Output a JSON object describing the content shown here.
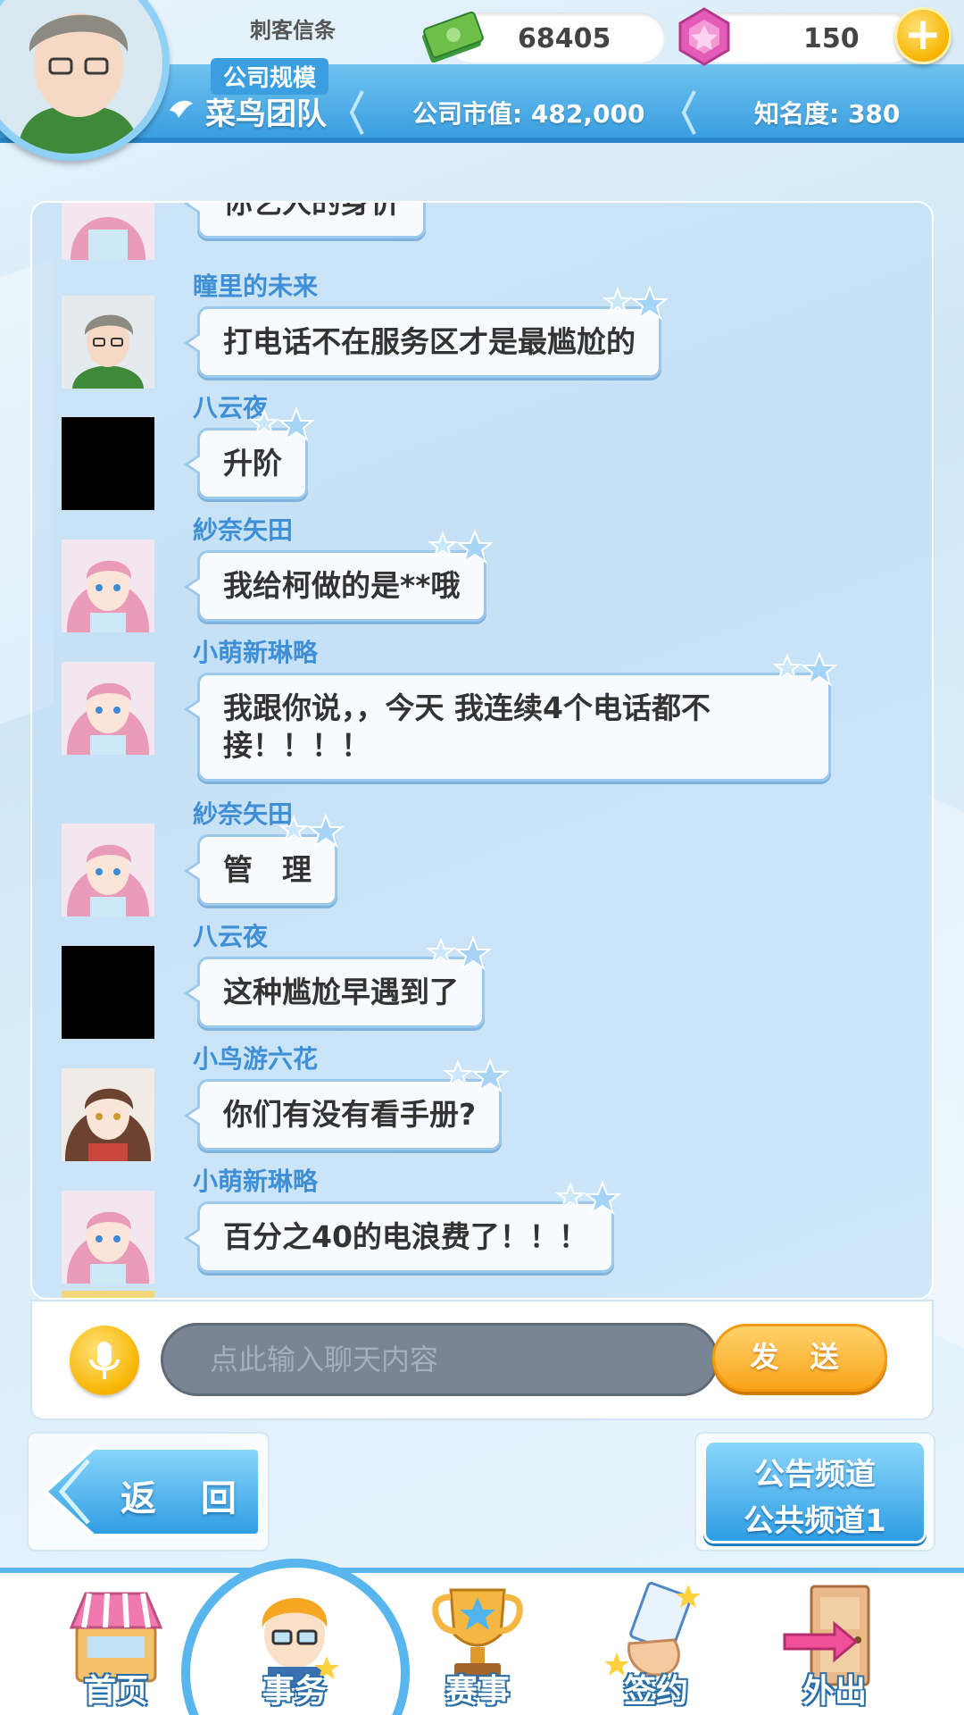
{
  "header": {
    "username": "刺客信条",
    "cash": "68405",
    "gems": "150",
    "scale_label": "公司规模",
    "team": "菜鸟团队",
    "market_value": "公司市值: 482,000",
    "fame": "知名度: 380"
  },
  "chat": {
    "messages": [
      {
        "name": "",
        "text": "你艺人的身价",
        "avatar": "pink-hair-girl"
      },
      {
        "name": "瞳里的未来",
        "text": "打电话不在服务区才是最尴尬的",
        "avatar": "glasses-boy"
      },
      {
        "name": "八云夜",
        "text": "升阶",
        "avatar": "black"
      },
      {
        "name": "紗奈矢田",
        "text": "我给柯做的是**哦",
        "avatar": "pink-hair-girl"
      },
      {
        "name": "小萌新琳略",
        "text": "我跟你说，，今天 我连续4个电话都不接！！！！",
        "avatar": "pink-hair-girl"
      },
      {
        "name": "紗奈矢田",
        "text": "管　理",
        "avatar": "pink-hair-girl"
      },
      {
        "name": "八云夜",
        "text": "这种尴尬早遇到了",
        "avatar": "black"
      },
      {
        "name": "小鸟游六花",
        "text": "你们有没有看手册?",
        "avatar": "brown-hair-girl"
      },
      {
        "name": "小萌新琳略",
        "text": "百分之40的电浪费了！！！",
        "avatar": "pink-hair-girl"
      }
    ]
  },
  "input": {
    "placeholder": "点此输入聊天内容",
    "send_label": "发 送"
  },
  "buttons": {
    "back_label": "返 回",
    "channel_line1": "公告频道",
    "channel_line2": "公共频道1"
  },
  "nav": {
    "items": [
      {
        "label": "首页",
        "icon": "shop-icon"
      },
      {
        "label": "事务",
        "icon": "manager-icon"
      },
      {
        "label": "赛事",
        "icon": "trophy-icon"
      },
      {
        "label": "签约",
        "icon": "contract-icon"
      },
      {
        "label": "外出",
        "icon": "door-icon"
      }
    ]
  },
  "colors": {
    "accent_blue": "#3a9ee0",
    "name_blue": "#3f8fd6",
    "gold": "#f7b500",
    "send_orange": "#f7a41a"
  }
}
